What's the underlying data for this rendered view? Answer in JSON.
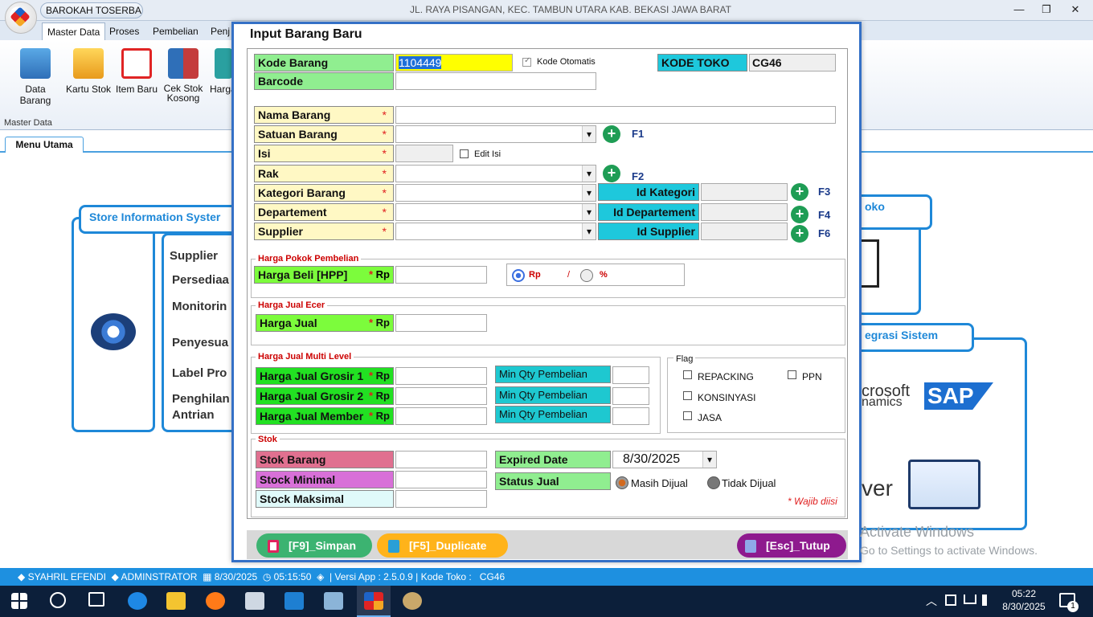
{
  "app": {
    "name": "BAROKAH  TOSERBA",
    "address": "JL. RAYA PISANGAN, KEC. TAMBUN UTARA KAB. BEKASI JAWA BARAT",
    "min": "—",
    "restore": "❐",
    "close": "✕"
  },
  "ribbon": {
    "tabs": [
      "Master Data",
      "Proses",
      "Pembelian",
      "Penj"
    ],
    "items": [
      {
        "label": "Data Barang",
        "icon": "database-icon"
      },
      {
        "label": "Kartu Stok",
        "icon": "cart-icon"
      },
      {
        "label": "Item Baru",
        "icon": "new-document-icon"
      },
      {
        "label": "Cek Stok Kosong",
        "icon": "boxes-icon"
      },
      {
        "label": "Harga",
        "icon": "price-icon"
      }
    ],
    "group": "Master Data"
  },
  "menu_tab": "Menu Utama",
  "background": {
    "store_info": "Store Information Syster",
    "menu": [
      "Supplier",
      "Persediaa",
      "Monitorin",
      "Penyesua",
      "Label Pro",
      "Penghilan",
      "Antrian"
    ],
    "toko": "oko",
    "integrasi": "egrasi Sistem",
    "logos": [
      "crosoft",
      "namics",
      "SAP",
      "ver"
    ]
  },
  "dialog": {
    "title": "Input Barang Baru",
    "kode_barang": {
      "label": "Kode Barang",
      "value": "1104449",
      "auto_label": "Kode Otomatis"
    },
    "kode_toko": {
      "label": "KODE TOKO",
      "value": "CG46"
    },
    "barcode": {
      "label": "Barcode"
    },
    "nama_barang": "Nama Barang",
    "satuan": "Satuan Barang",
    "isi": "Isi",
    "edit_isi": "Edit Isi",
    "rak": "Rak",
    "kategori": "Kategori Barang",
    "departement": "Departement",
    "supplier": "Supplier",
    "id_kategori": "Id Kategori",
    "id_departement": "Id Departement",
    "id_supplier": "Id Supplier",
    "req": "*",
    "fkeys": {
      "f1": "F1",
      "f2": "F2",
      "f3": "F3",
      "f4": "F4",
      "f6": "F6"
    },
    "hpp_section": "Harga Pokok Pembelian",
    "harga_beli": "Harga Beli [HPP]",
    "rp": "Rp",
    "req_rp": "* Rp",
    "radio_rp": "Rp",
    "slash": "/",
    "radio_pct": "%",
    "ecer_section": "Harga Jual Ecer",
    "harga_jual": "Harga Jual",
    "multi_section": "Harga Jual Multi Level",
    "grosir1": "Harga Jual Grosir 1",
    "grosir2": "Harga Jual Grosir 2",
    "member": "Harga Jual Member",
    "min_qty": "Min Qty Pembelian",
    "flag_section": "Flag",
    "flags": {
      "repacking": "REPACKING",
      "ppn": "PPN",
      "konsinyasi": "KONSINYASI",
      "jasa": "JASA"
    },
    "stok_section": "Stok",
    "stok_barang": "Stok Barang",
    "stok_min": "Stock Minimal",
    "stok_max": "Stock Maksimal",
    "expired": "Expired Date",
    "expired_value": "8/30/2025",
    "status_jual": "Status Jual",
    "masih": "Masih Dijual",
    "tidak": "Tidak Dijual",
    "wajib": "* Wajib diisi",
    "btn_simpan": "[F9]_Simpan",
    "btn_duplicate": "[F5]_Duplicate",
    "btn_tutup": "[Esc]_Tutup"
  },
  "watermark": {
    "line1": "Activate Windows",
    "line2": "Go to Settings to activate Windows."
  },
  "status": {
    "user": "SYAHRIL EFENDI",
    "role": "ADMINSTRATOR",
    "date": "8/30/2025",
    "time": "05:15:50",
    "versi": "|  Versi App : 2.5.0.9  |  Kode Toko :",
    "toko": "CG46"
  },
  "taskbar": {
    "time": "05:22",
    "date": "8/30/2025",
    "notif": "1"
  }
}
